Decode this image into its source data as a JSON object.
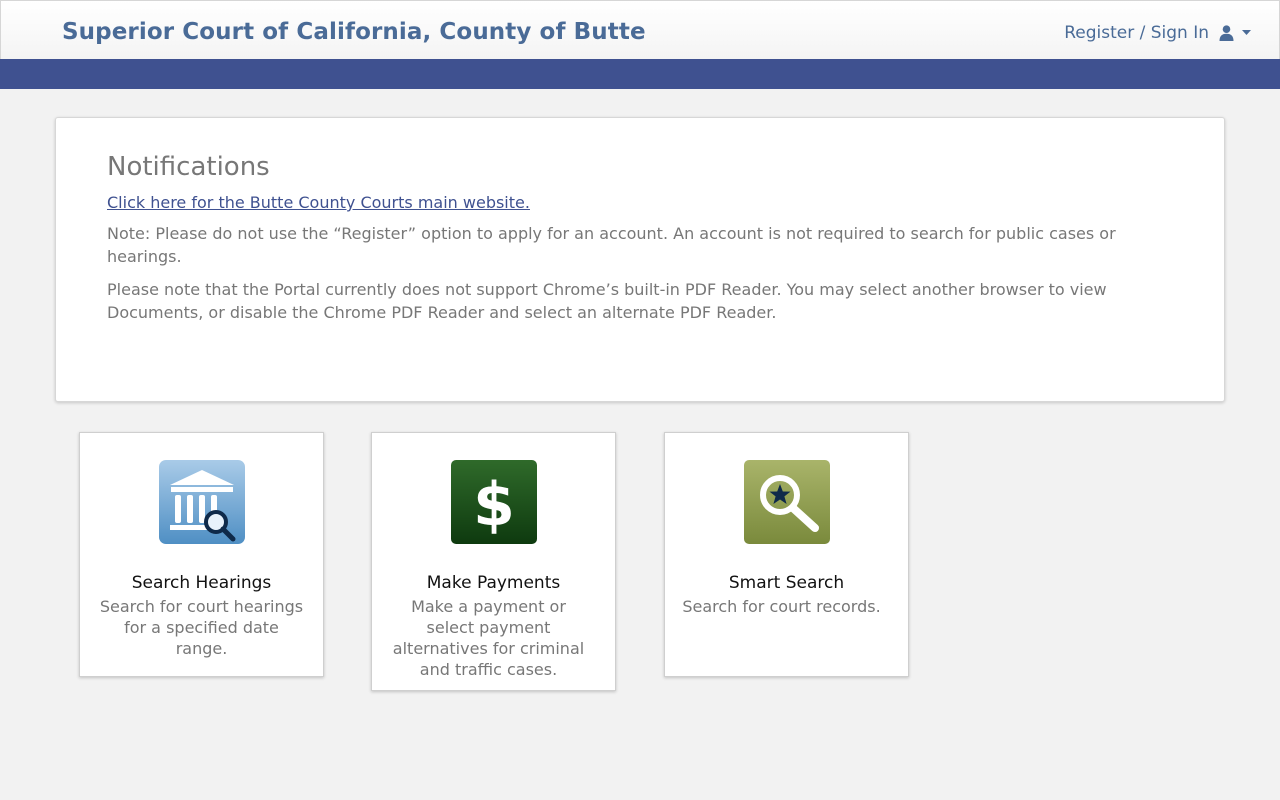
{
  "header": {
    "title": "Superior Court of California, County of Butte",
    "user_menu_label": "Register / Sign In",
    "user_icon": "user-icon",
    "caret_icon": "caret-down-icon"
  },
  "colors": {
    "brand_blue": "#3f5190",
    "title_blue": "#4a6b97",
    "muted_text": "#777777"
  },
  "notifications": {
    "heading": "Notifications",
    "link_text": "Click here for the Butte County Courts main website.",
    "notes": [
      "Note: Please do not use the “Register” option to apply for an account. An account is not required to search for public cases or hearings.",
      "Please note that the Portal currently does not support Chrome’s built-in PDF Reader. You may select another browser to view Documents, or disable the Chrome PDF Reader and select an alternate PDF Reader."
    ]
  },
  "tiles": [
    {
      "title": "Search Hearings",
      "description": "Search for court hearings for a specified date range.",
      "icon": "courthouse-search-icon"
    },
    {
      "title": "Make Payments",
      "description": "Make a payment or select payment alternatives for criminal and traffic cases.",
      "icon": "dollar-icon"
    },
    {
      "title": "Smart Search",
      "description": "Search for court records.",
      "icon": "star-magnifier-icon"
    }
  ]
}
